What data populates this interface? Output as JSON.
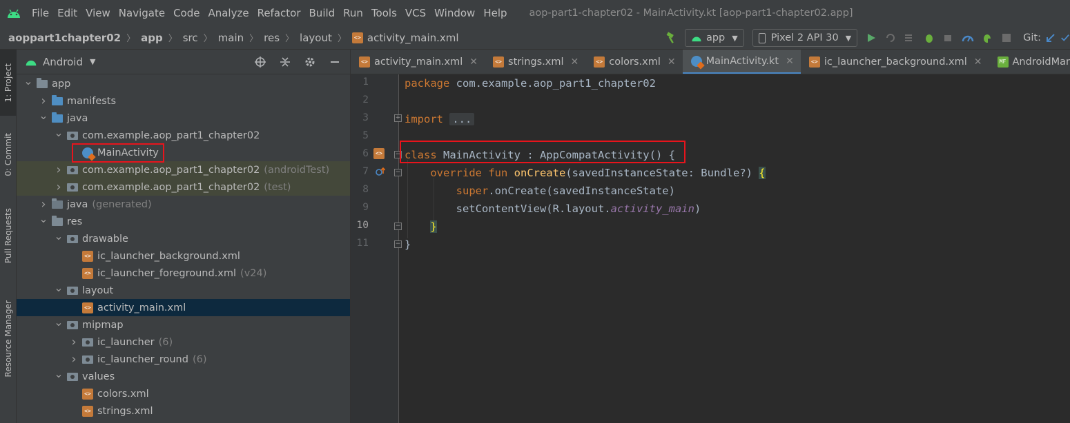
{
  "menubar": {
    "items": [
      "File",
      "Edit",
      "View",
      "Navigate",
      "Code",
      "Analyze",
      "Refactor",
      "Build",
      "Run",
      "Tools",
      "VCS",
      "Window",
      "Help"
    ],
    "title": "aop-part1-chapter02 - MainActivity.kt [aop-part1-chapter02.app]"
  },
  "navbar": {
    "breadcrumb": [
      "aoppart1chapter02",
      "app",
      "src",
      "main",
      "res",
      "layout",
      "activity_main.xml"
    ],
    "run_config": "app",
    "device": "Pixel 2 API 30",
    "git_label": "Git:"
  },
  "toolstrip": {
    "project": "1: Project",
    "commit": "0: Commit",
    "pull_requests": "Pull Requests",
    "resource_manager": "Resource Manager"
  },
  "project_panel": {
    "view_mode": "Android",
    "tree": [
      {
        "label": "app",
        "suffix": "",
        "depth": 0,
        "expanded": true,
        "icon": "module-icon"
      },
      {
        "label": "manifests",
        "suffix": "",
        "depth": 1,
        "expanded": false,
        "icon": "folder-icon"
      },
      {
        "label": "java",
        "suffix": "",
        "depth": 1,
        "expanded": true,
        "icon": "source-folder-icon"
      },
      {
        "label": "com.example.aop_part1_chapter02",
        "suffix": "",
        "depth": 2,
        "expanded": true,
        "icon": "package-icon"
      },
      {
        "label": "MainActivity",
        "suffix": "",
        "depth": 3,
        "expanded": null,
        "icon": "kotlin-class-icon"
      },
      {
        "label": "com.example.aop_part1_chapter02",
        "suffix": "(androidTest)",
        "depth": 2,
        "expanded": false,
        "icon": "package-icon"
      },
      {
        "label": "com.example.aop_part1_chapter02",
        "suffix": "(test)",
        "depth": 2,
        "expanded": false,
        "icon": "package-icon"
      },
      {
        "label": "java",
        "suffix": "(generated)",
        "depth": 1,
        "expanded": false,
        "icon": "generated-folder-icon"
      },
      {
        "label": "res",
        "suffix": "",
        "depth": 1,
        "expanded": true,
        "icon": "res-folder-icon"
      },
      {
        "label": "drawable",
        "suffix": "",
        "depth": 2,
        "expanded": true,
        "icon": "package-icon"
      },
      {
        "label": "ic_launcher_background.xml",
        "suffix": "",
        "depth": 3,
        "expanded": null,
        "icon": "xml-file-icon"
      },
      {
        "label": "ic_launcher_foreground.xml",
        "suffix": "(v24)",
        "depth": 3,
        "expanded": null,
        "icon": "xml-file-icon"
      },
      {
        "label": "layout",
        "suffix": "",
        "depth": 2,
        "expanded": true,
        "icon": "package-icon"
      },
      {
        "label": "activity_main.xml",
        "suffix": "",
        "depth": 3,
        "expanded": null,
        "icon": "xml-file-icon"
      },
      {
        "label": "mipmap",
        "suffix": "",
        "depth": 2,
        "expanded": true,
        "icon": "package-icon"
      },
      {
        "label": "ic_launcher",
        "suffix": "(6)",
        "depth": 3,
        "expanded": false,
        "icon": "package-icon"
      },
      {
        "label": "ic_launcher_round",
        "suffix": "(6)",
        "depth": 3,
        "expanded": false,
        "icon": "package-icon"
      },
      {
        "label": "values",
        "suffix": "",
        "depth": 2,
        "expanded": true,
        "icon": "package-icon"
      },
      {
        "label": "colors.xml",
        "suffix": "",
        "depth": 3,
        "expanded": null,
        "icon": "xml-file-icon"
      },
      {
        "label": "strings.xml",
        "suffix": "",
        "depth": 3,
        "expanded": null,
        "icon": "xml-file-icon"
      }
    ]
  },
  "tabs": [
    {
      "label": "activity_main.xml",
      "icon": "xml-file-icon",
      "active": false
    },
    {
      "label": "strings.xml",
      "icon": "xml-file-icon",
      "active": false
    },
    {
      "label": "colors.xml",
      "icon": "xml-file-icon",
      "active": false
    },
    {
      "label": "MainActivity.kt",
      "icon": "kotlin-class-icon",
      "active": true
    },
    {
      "label": "ic_launcher_background.xml",
      "icon": "xml-file-icon",
      "active": false
    },
    {
      "label": "AndroidManifest.xml",
      "icon": "manifest-icon",
      "active": false
    }
  ],
  "editor": {
    "line_numbers": [
      "1",
      "2",
      "3",
      "5",
      "6",
      "7",
      "8",
      "9",
      "10",
      "11"
    ],
    "current_line": "10",
    "code": {
      "l1_kw": "package",
      "l1_rest": " com.example.aop_part1_chapter02",
      "l3_kw": "import",
      "l3_collapsed": "...",
      "l6_kw": "class",
      "l6_rest": " MainActivity : AppCompatActivity()",
      "l6_brace": " {",
      "l7_kw": "override fun",
      "l7_fn": "onCreate",
      "l7_rest": "(savedInstanceState: Bundle?) ",
      "l7_brace": "{",
      "l8_kw": "super",
      "l8_rest": ".onCreate(savedInstanceState)",
      "l9_a": "setContentView(R.layout.",
      "l9_it": "activity_main",
      "l9_b": ")",
      "l10_brace": "}",
      "l11_brace": "}"
    }
  },
  "colors": {
    "highlight_box": "#e8141c",
    "keyword": "#cc7832",
    "function": "#ffc66d"
  }
}
